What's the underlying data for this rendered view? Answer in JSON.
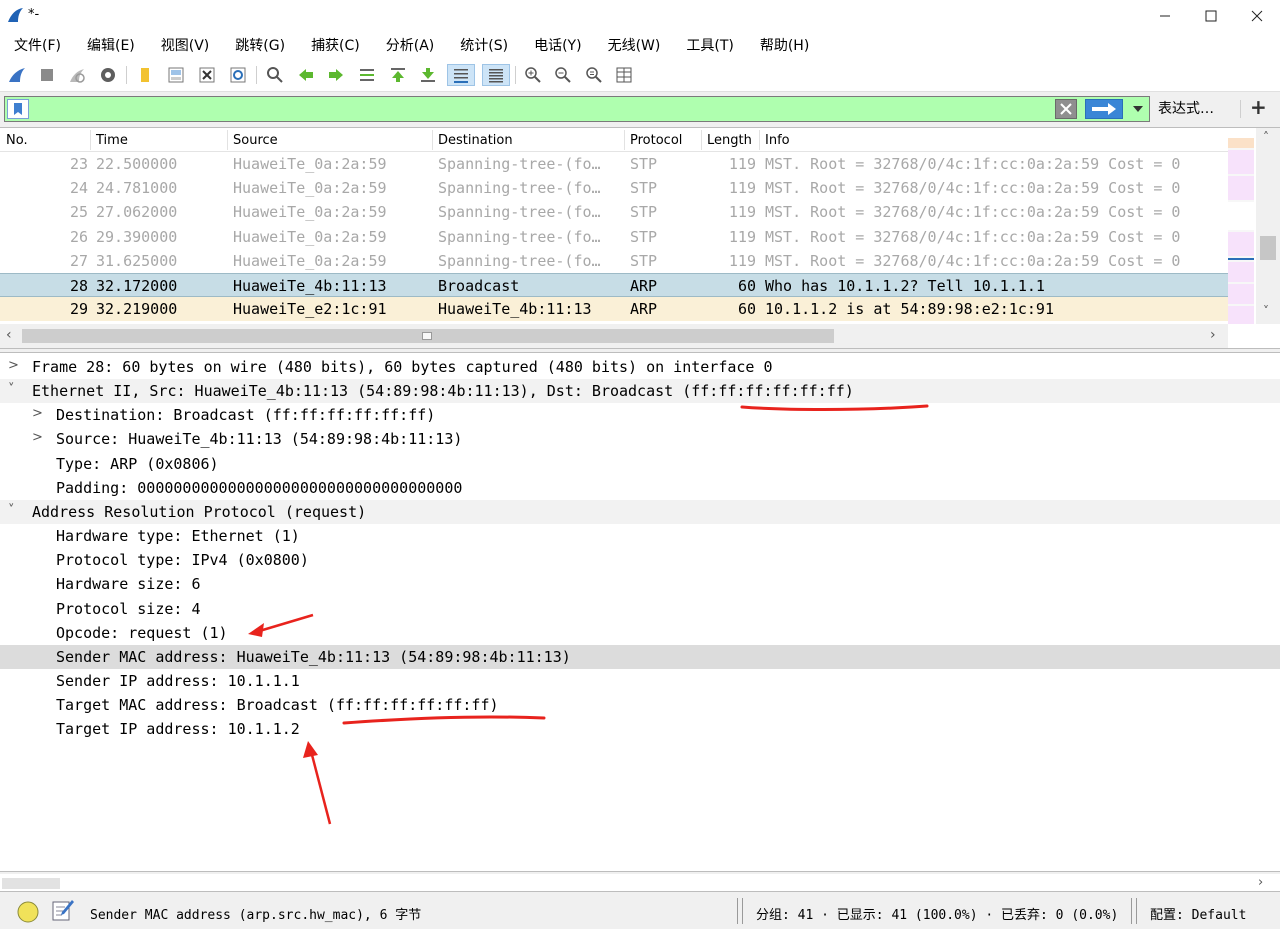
{
  "window": {
    "title": "*-",
    "minimize": "—",
    "maximize": "☐",
    "close": "✕"
  },
  "menu": [
    "文件(F)",
    "编辑(E)",
    "视图(V)",
    "跳转(G)",
    "捕获(C)",
    "分析(A)",
    "统计(S)",
    "电话(Y)",
    "无线(W)",
    "工具(T)",
    "帮助(H)"
  ],
  "toolbar": {
    "icons": [
      "shark-fin-start-icon",
      "stop-capture-icon",
      "restart-capture-icon",
      "capture-options-icon",
      "open-file-icon",
      "save-file-icon",
      "close-file-icon",
      "reload-file-icon",
      "find-packet-icon",
      "go-back-icon",
      "go-forward-icon",
      "go-to-packet-icon",
      "go-first-icon",
      "go-last-icon",
      "autoscroll-icon",
      "colorize-icon",
      "zoom-in-icon",
      "zoom-out-icon",
      "zoom-normal-icon",
      "resize-columns-icon"
    ]
  },
  "filter": {
    "value": "",
    "expression_label": "表达式…",
    "add_label": "+"
  },
  "packet_list": {
    "columns": [
      "No.",
      "Time",
      "Source",
      "Destination",
      "Protocol",
      "Length",
      "Info"
    ],
    "rows": [
      {
        "no": "23",
        "time": "22.500000",
        "source": "HuaweiTe_0a:2a:59",
        "destination": "Spanning-tree-(fo…",
        "protocol": "STP",
        "length": "119",
        "info": "MST. Root = 32768/0/4c:1f:cc:0a:2a:59  Cost = 0",
        "style": "dim"
      },
      {
        "no": "24",
        "time": "24.781000",
        "source": "HuaweiTe_0a:2a:59",
        "destination": "Spanning-tree-(fo…",
        "protocol": "STP",
        "length": "119",
        "info": "MST. Root = 32768/0/4c:1f:cc:0a:2a:59  Cost = 0",
        "style": "dim"
      },
      {
        "no": "25",
        "time": "27.062000",
        "source": "HuaweiTe_0a:2a:59",
        "destination": "Spanning-tree-(fo…",
        "protocol": "STP",
        "length": "119",
        "info": "MST. Root = 32768/0/4c:1f:cc:0a:2a:59  Cost = 0",
        "style": "dim"
      },
      {
        "no": "26",
        "time": "29.390000",
        "source": "HuaweiTe_0a:2a:59",
        "destination": "Spanning-tree-(fo…",
        "protocol": "STP",
        "length": "119",
        "info": "MST. Root = 32768/0/4c:1f:cc:0a:2a:59  Cost = 0",
        "style": "dim"
      },
      {
        "no": "27",
        "time": "31.625000",
        "source": "HuaweiTe_0a:2a:59",
        "destination": "Spanning-tree-(fo…",
        "protocol": "STP",
        "length": "119",
        "info": "MST. Root = 32768/0/4c:1f:cc:0a:2a:59  Cost = 0",
        "style": "dim"
      },
      {
        "no": "28",
        "time": "32.172000",
        "source": "HuaweiTe_4b:11:13",
        "destination": "Broadcast",
        "protocol": "ARP",
        "length": "60",
        "info": "Who has 10.1.1.2? Tell 10.1.1.1",
        "style": "sel"
      },
      {
        "no": "29",
        "time": "32.219000",
        "source": "HuaweiTe_e2:1c:91",
        "destination": "HuaweiTe_4b:11:13",
        "protocol": "ARP",
        "length": "60",
        "info": "10.1.1.2 is at 54:89:98:e2:1c:91",
        "style": "arp"
      }
    ],
    "hscroll_left": "‹",
    "hscroll_right": "›",
    "vscroll_up": "˄",
    "vscroll_down": "˅"
  },
  "details": {
    "rows": [
      {
        "indent": 0,
        "expander": ">",
        "text": "Frame 28: 60 bytes on wire (480 bits), 60 bytes captured (480 bits) on interface 0",
        "style": "normal"
      },
      {
        "indent": 0,
        "expander": "˅",
        "text": "Ethernet II, Src: HuaweiTe_4b:11:13 (54:89:98:4b:11:13), Dst: Broadcast (ff:ff:ff:ff:ff:ff)",
        "style": "section"
      },
      {
        "indent": 1,
        "expander": ">",
        "text": "Destination: Broadcast (ff:ff:ff:ff:ff:ff)",
        "style": "normal"
      },
      {
        "indent": 1,
        "expander": ">",
        "text": "Source: HuaweiTe_4b:11:13 (54:89:98:4b:11:13)",
        "style": "normal"
      },
      {
        "indent": 1,
        "expander": "",
        "text": "Type: ARP (0x0806)",
        "style": "normal"
      },
      {
        "indent": 1,
        "expander": "",
        "text": "Padding: 000000000000000000000000000000000000",
        "style": "normal"
      },
      {
        "indent": 0,
        "expander": "˅",
        "text": "Address Resolution Protocol (request)",
        "style": "section"
      },
      {
        "indent": 1,
        "expander": "",
        "text": "Hardware type: Ethernet (1)",
        "style": "normal"
      },
      {
        "indent": 1,
        "expander": "",
        "text": "Protocol type: IPv4 (0x0800)",
        "style": "normal"
      },
      {
        "indent": 1,
        "expander": "",
        "text": "Hardware size: 6",
        "style": "normal"
      },
      {
        "indent": 1,
        "expander": "",
        "text": "Protocol size: 4",
        "style": "normal"
      },
      {
        "indent": 1,
        "expander": "",
        "text": "Opcode: request (1)",
        "style": "normal"
      },
      {
        "indent": 1,
        "expander": "",
        "text": "Sender MAC address: HuaweiTe_4b:11:13 (54:89:98:4b:11:13)",
        "style": "hl"
      },
      {
        "indent": 1,
        "expander": "",
        "text": "Sender IP address: 10.1.1.1",
        "style": "normal"
      },
      {
        "indent": 1,
        "expander": "",
        "text": "Target MAC address: Broadcast (ff:ff:ff:ff:ff:ff)",
        "style": "normal"
      },
      {
        "indent": 1,
        "expander": "",
        "text": "Target IP address: 10.1.1.2",
        "style": "normal"
      }
    ]
  },
  "statusbar": {
    "field_info": "Sender MAC address (arp.src.hw_mac), 6 字节",
    "packets": "分组: 41 · 已显示: 41 (100.0%) · 已丢弃: 0 (0.0%)",
    "profile": "配置: Default"
  },
  "colors": {
    "filter_bg": "#afffaf",
    "selected_row": "#c7dde6",
    "arp_row": "#faf0d7",
    "annotation_red": "#e8231d"
  }
}
